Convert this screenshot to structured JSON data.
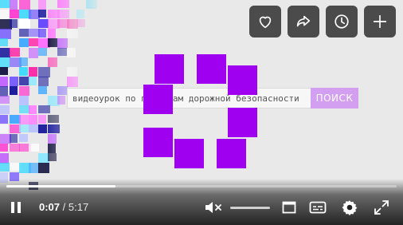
{
  "video": {
    "search_query": "видеоурок по правилам дорожной безопасности",
    "search_button": "ПОИСК"
  },
  "top_actions": [
    {
      "name": "like",
      "icon": "heart-icon"
    },
    {
      "name": "share",
      "icon": "share-arrow-icon"
    },
    {
      "name": "watch-later",
      "icon": "clock-icon"
    },
    {
      "name": "add",
      "icon": "plus-icon"
    }
  ],
  "player": {
    "current_time": "0:07",
    "separator": "/",
    "duration": "5:17",
    "progress_fraction": 0.28,
    "volume_muted": true
  },
  "colors": {
    "loader_square": "#a000f0",
    "search_button": "#d39ff0"
  }
}
